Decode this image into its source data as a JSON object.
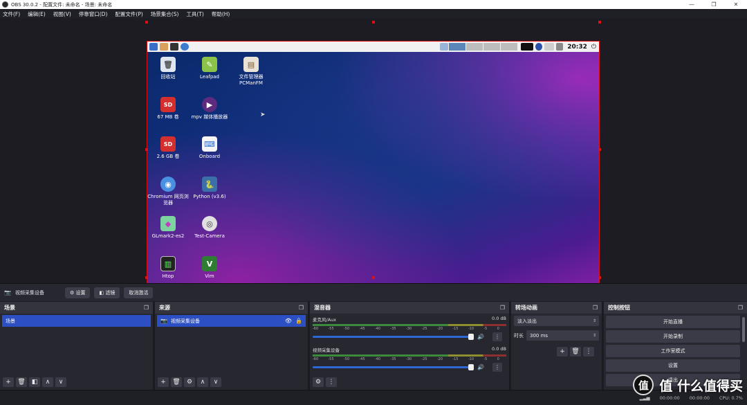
{
  "window": {
    "title": "OBS 30.0.2 - 配置文件: 未命名 - 场景: 未命名",
    "minimize": "—",
    "maximize": "❐",
    "close": "✕"
  },
  "menu": [
    "文件(F)",
    "编辑(E)",
    "视图(V)",
    "停靠窗口(D)",
    "配置文件(P)",
    "场景集合(S)",
    "工具(T)",
    "帮助(H)"
  ],
  "desktop": {
    "clock": "20:32",
    "icons": [
      {
        "label": "回收站",
        "glyph": "🗑",
        "color": "#dfe6ef"
      },
      {
        "label": "Leafpad",
        "glyph": "✎",
        "color": "#8bc34a"
      },
      {
        "label": "文件管理器 PCManFM",
        "glyph": "▤",
        "color": "#e9e3d7"
      },
      {
        "label": "67 MB 卷",
        "glyph": "SD",
        "color": "#d32f2f"
      },
      {
        "label": "mpv 媒体播放器",
        "glyph": "▶",
        "color": "#5e2a7e"
      },
      {
        "label": "2.6 GB 卷",
        "glyph": "SD",
        "color": "#d32f2f"
      },
      {
        "label": "Onboard",
        "glyph": "⌨",
        "color": "#f5f5f5"
      },
      {
        "label": "Chromium 网页浏览器",
        "glyph": "◉",
        "color": "#4a90e2"
      },
      {
        "label": "Python (v3.6)",
        "glyph": "🐍",
        "color": "#3b6fa8"
      },
      {
        "label": "GLmark2-es2",
        "glyph": "◆",
        "color": "#7cd3a0"
      },
      {
        "label": "Test-Camera",
        "glyph": "◎",
        "color": "#e0e0e0"
      },
      {
        "label": "Htop",
        "glyph": "▥",
        "color": "#222"
      },
      {
        "label": "Vim",
        "glyph": "V",
        "color": "#2e7d32"
      }
    ]
  },
  "source_toolbar": {
    "source_name": "视频采集设备",
    "settings": "⚙ 设置",
    "filters": "◧ 滤镜",
    "deactivate": "取消激活"
  },
  "scenes": {
    "title": "场景",
    "items": [
      "场景"
    ]
  },
  "sources": {
    "title": "来源",
    "items": [
      {
        "name": "视频采集设备",
        "visible_icon": "👁",
        "lock_icon": "🔒"
      }
    ]
  },
  "mixer": {
    "title": "混音器",
    "ticks": [
      "-60",
      "-55",
      "-50",
      "-45",
      "-40",
      "-35",
      "-30",
      "-25",
      "-20",
      "-15",
      "-10",
      "-5",
      "0"
    ],
    "channels": [
      {
        "name": "麦克风/Aux",
        "db": "0.0 dB",
        "volume": 1.0
      },
      {
        "name": "视频采集设备",
        "db": "0.0 dB",
        "volume": 1.0
      }
    ]
  },
  "transitions": {
    "title": "转场动画",
    "type": "淡入淡出",
    "duration_label": "时长",
    "duration": "300 ms"
  },
  "controls": {
    "title": "控制按钮",
    "buttons": [
      "开始直播",
      "开始录制",
      "工作室模式",
      "设置",
      "退出"
    ]
  },
  "status": {
    "stream_time": "00:00:00",
    "rec_time": "00:00:00",
    "cpu": "CPU: 0.7%"
  },
  "watermark": {
    "text": "值 什么值得买"
  }
}
